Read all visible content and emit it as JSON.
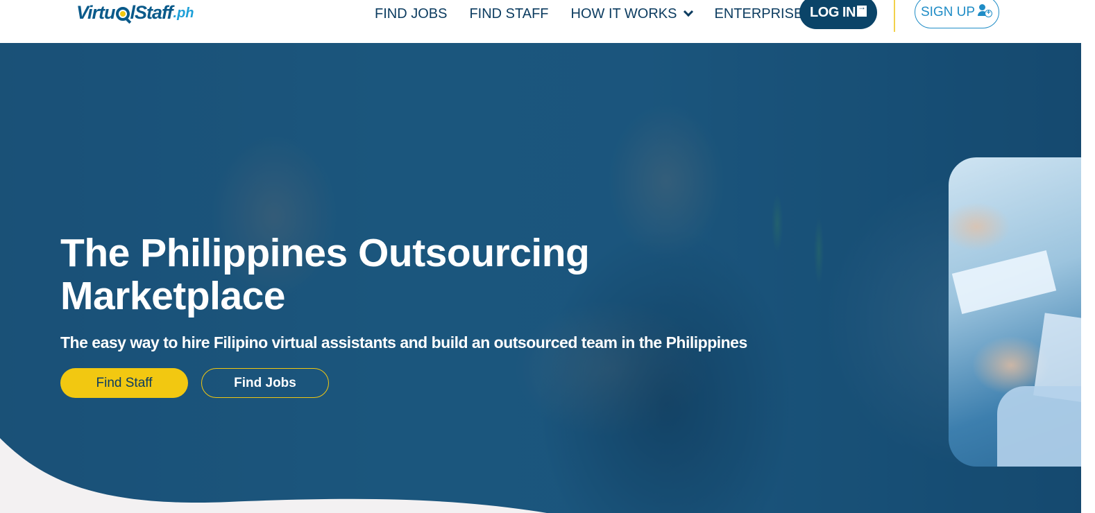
{
  "brand": {
    "logo_main_a": "Virtu",
    "logo_main_b": "lStaff",
    "logo_suffix": ".ph"
  },
  "nav": {
    "items": [
      {
        "label": "FIND JOBS"
      },
      {
        "label": "FIND STAFF"
      },
      {
        "label": "HOW IT WORKS"
      },
      {
        "label": "ENTERPRISE"
      }
    ],
    "login_label": "LOG IN",
    "signup_label": "SIGN UP"
  },
  "hero": {
    "title_line1": "The Philippines Outsourcing",
    "title_line2": "Marketplace",
    "subtitle": "The easy way to hire Filipino virtual assistants and build an outsourced team in the Philippines",
    "find_staff_label": "Find Staff",
    "find_jobs_label": "Find Jobs"
  },
  "colors": {
    "navy": "#0b4468",
    "accent_yellow": "#f2c811",
    "link_blue": "#1f8cc6",
    "overlay": "#0e466e"
  },
  "icons": {
    "dropdown": "chevron-down-icon",
    "login": "login-icon",
    "signup": "add-user-icon"
  }
}
